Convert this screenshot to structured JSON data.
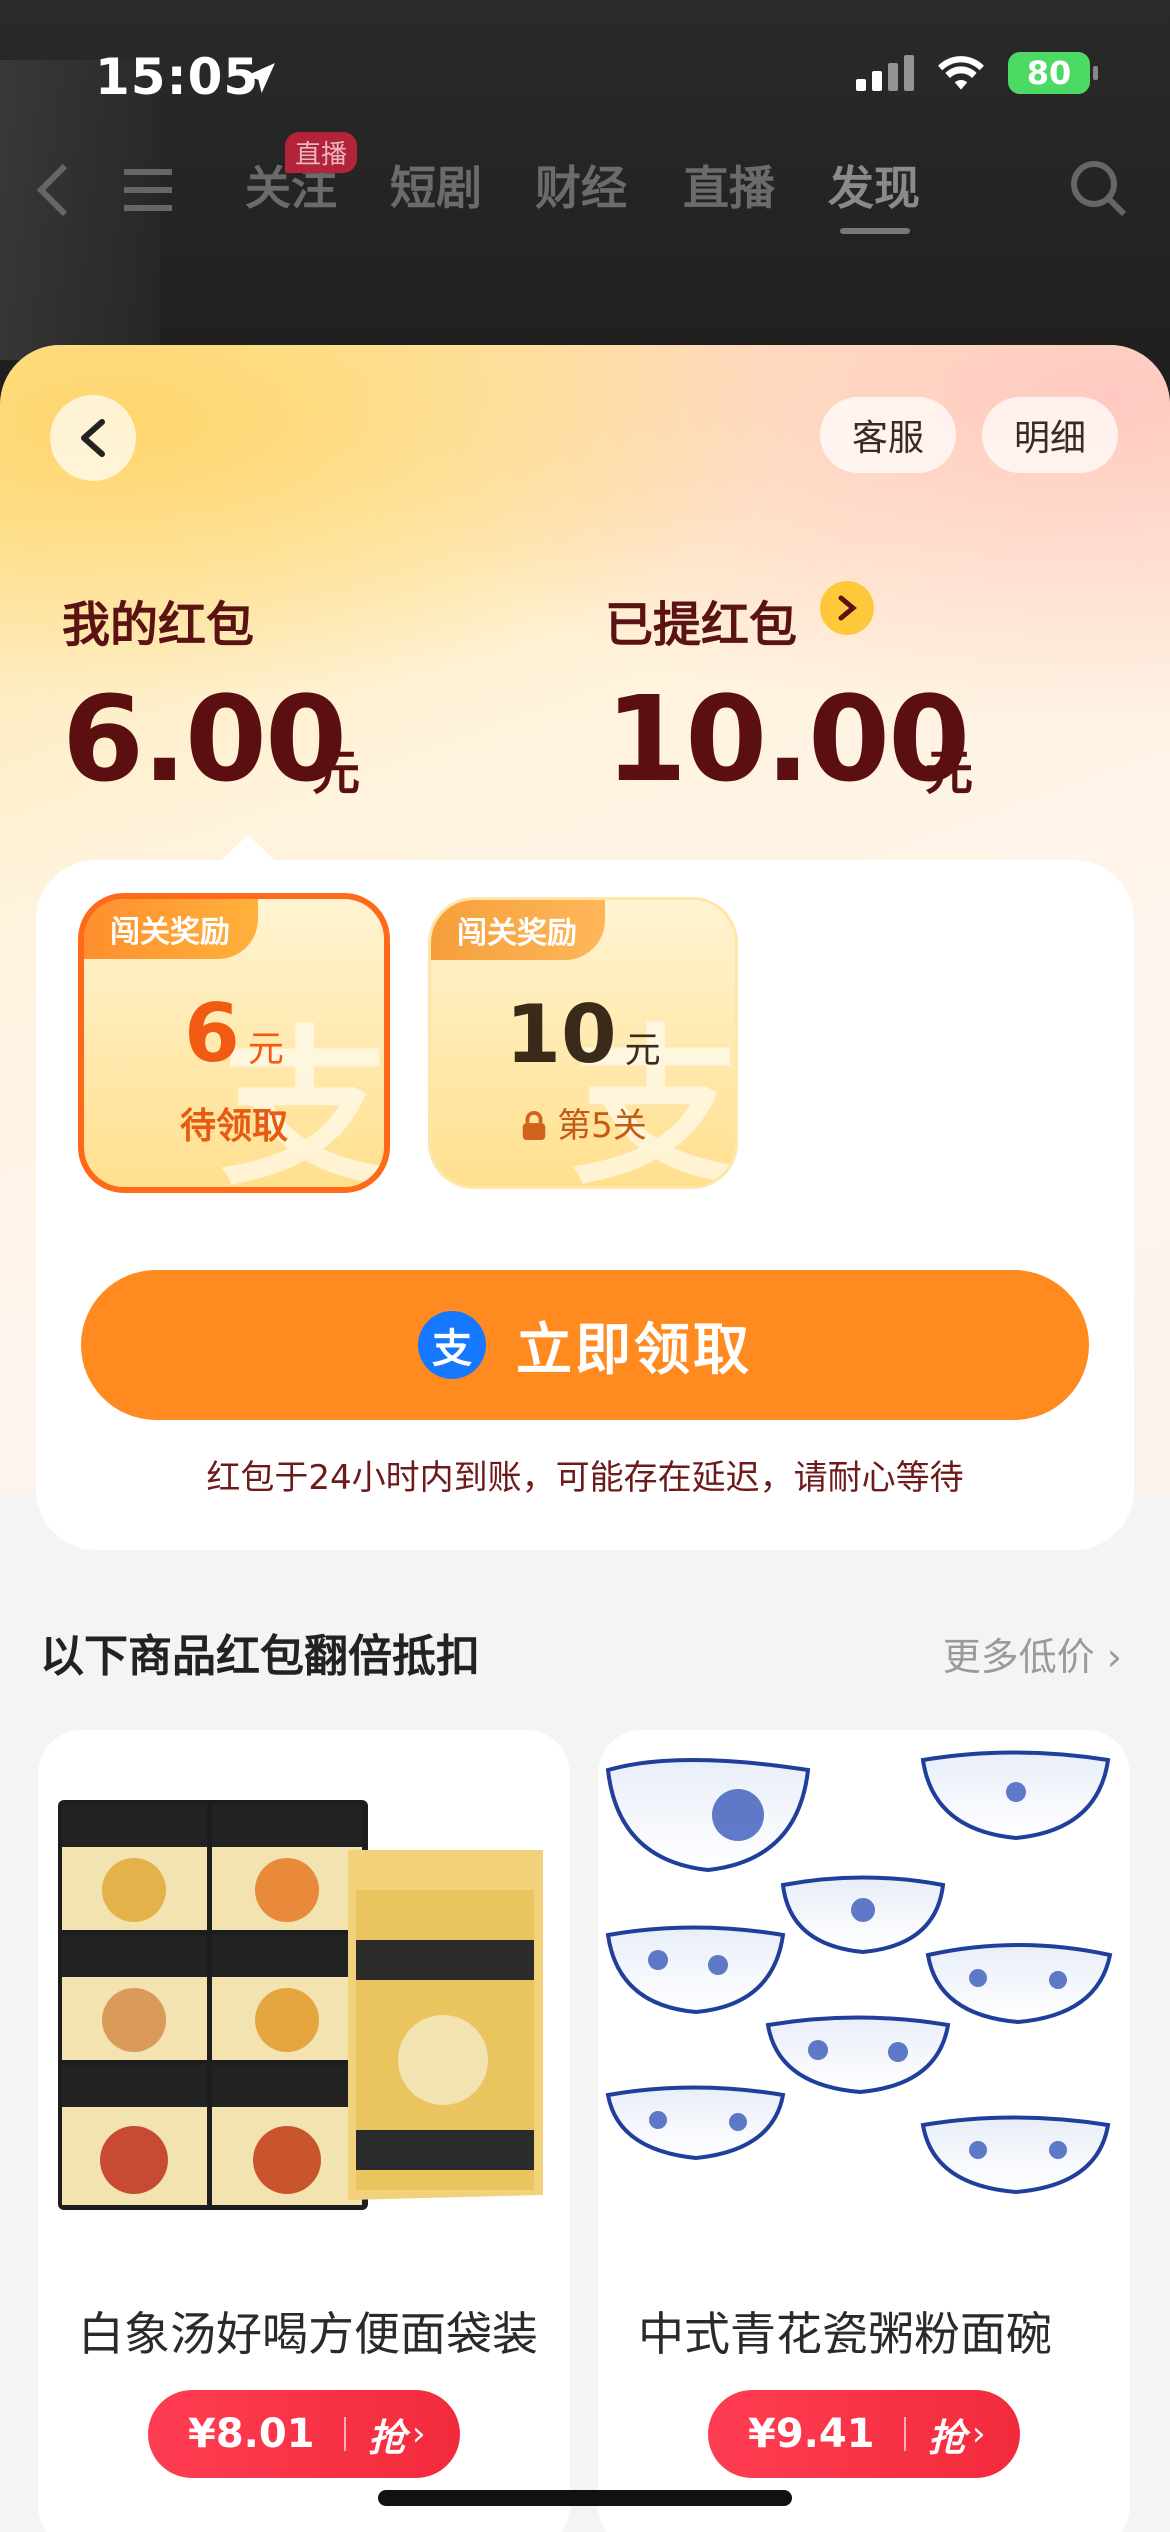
{
  "status_bar": {
    "time": "15:05",
    "battery": "80"
  },
  "background_app": {
    "tabs": [
      "关注",
      "短剧",
      "财经",
      "直播",
      "发现"
    ],
    "live_badge": "直播"
  },
  "header": {
    "service_label": "客服",
    "detail_label": "明细"
  },
  "balance": {
    "my_label": "我的红包",
    "my_amount": "6.00",
    "my_unit": "元",
    "withdrawn_label": "已提红包",
    "withdrawn_amount": "10.00",
    "withdrawn_unit": "元"
  },
  "rewards": [
    {
      "tag": "闯关奖励",
      "value": "6",
      "unit": "元",
      "status": "待领取"
    },
    {
      "tag": "闯关奖励",
      "value": "10",
      "unit": "元",
      "status": "第5关"
    }
  ],
  "claim": {
    "icon_text": "支",
    "label": "立即领取",
    "notice": "红包于24小时内到账，可能存在延迟，请耐心等待"
  },
  "products_section": {
    "title": "以下商品红包翻倍抵扣",
    "more_label": "更多低价"
  },
  "products": [
    {
      "name": "白象汤好喝方便面袋装",
      "price": "¥8.01",
      "grab": "抢"
    },
    {
      "name": "中式青花瓷粥粉面碗",
      "price": "¥9.41",
      "grab": "抢"
    }
  ],
  "colors": {
    "accent": "#ff8a1f",
    "price_red": "#f22a3c",
    "alipay_blue": "#1677ff"
  }
}
